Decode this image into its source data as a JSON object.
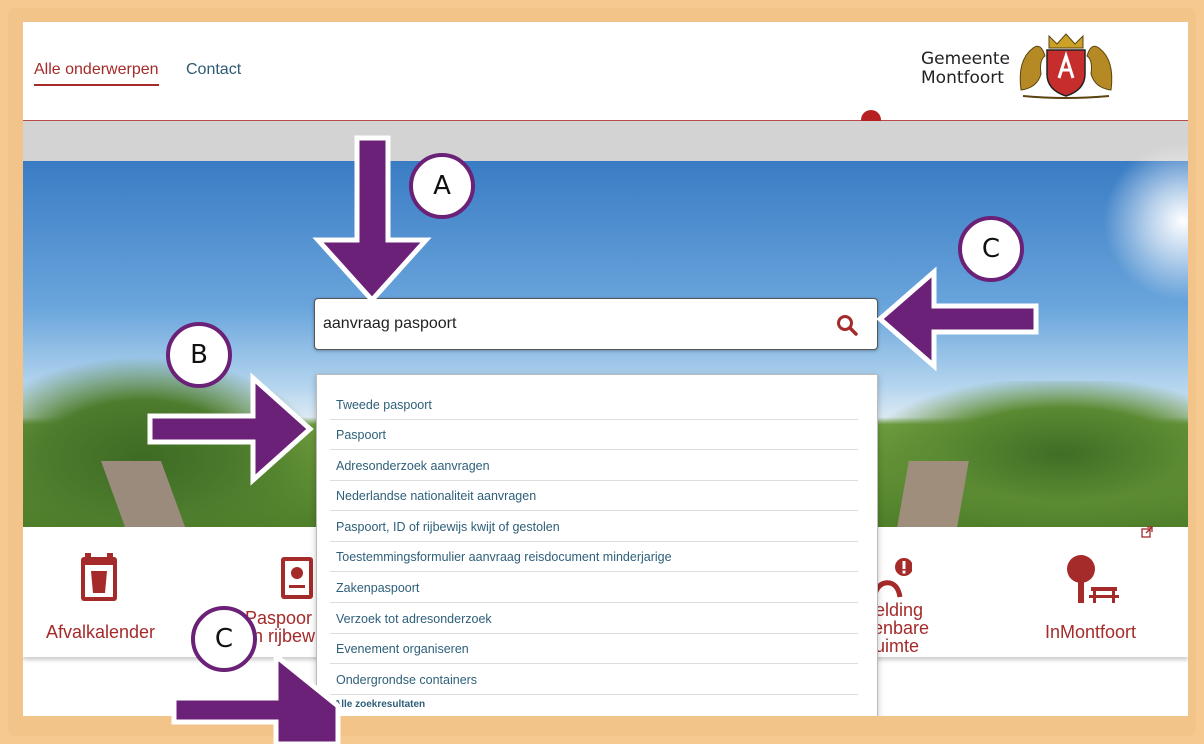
{
  "header": {
    "nav": [
      {
        "label": "Alle onderwerpen"
      },
      {
        "label": "Contact"
      }
    ],
    "logo": {
      "line1": "Gemeente",
      "line2": "Montfoort"
    }
  },
  "search": {
    "value": "aanvraag paspoort",
    "icon": "search-icon"
  },
  "suggestions": [
    "Tweede paspoort",
    "Paspoort",
    "Adresonderzoek aanvragen",
    "Nederlandse nationaliteit aanvragen",
    "Paspoort, ID of rijbewijs kwijt of gestolen",
    "Toestemmingsformulier aanvraag reisdocument minderjarige",
    "Zakenpaspoort",
    "Verzoek tot adresonderzoek",
    "Evenement organiseren",
    "Ondergrondse containers"
  ],
  "all_results_label": "Alle zoekresultaten",
  "tiles": [
    {
      "label": "Afvalkalender",
      "icon": "waste-bin-icon"
    },
    {
      "label_line1": "Paspoor",
      "label_line2": "en rijbew",
      "icon": "passport-icon"
    },
    {
      "label_line1": "elding",
      "label_line2": "enbare",
      "label_line3": "uimte",
      "icon": "alert-icon"
    },
    {
      "label": "InMontfoort",
      "icon": "tree-bench-icon"
    }
  ],
  "annotations": [
    "A",
    "B",
    "C",
    "C"
  ],
  "colors": {
    "brand_red": "#a52a2a",
    "link_blue": "#2e5f7a",
    "annotation_purple": "#6a2177",
    "frame_orange": "#f3c48a"
  }
}
